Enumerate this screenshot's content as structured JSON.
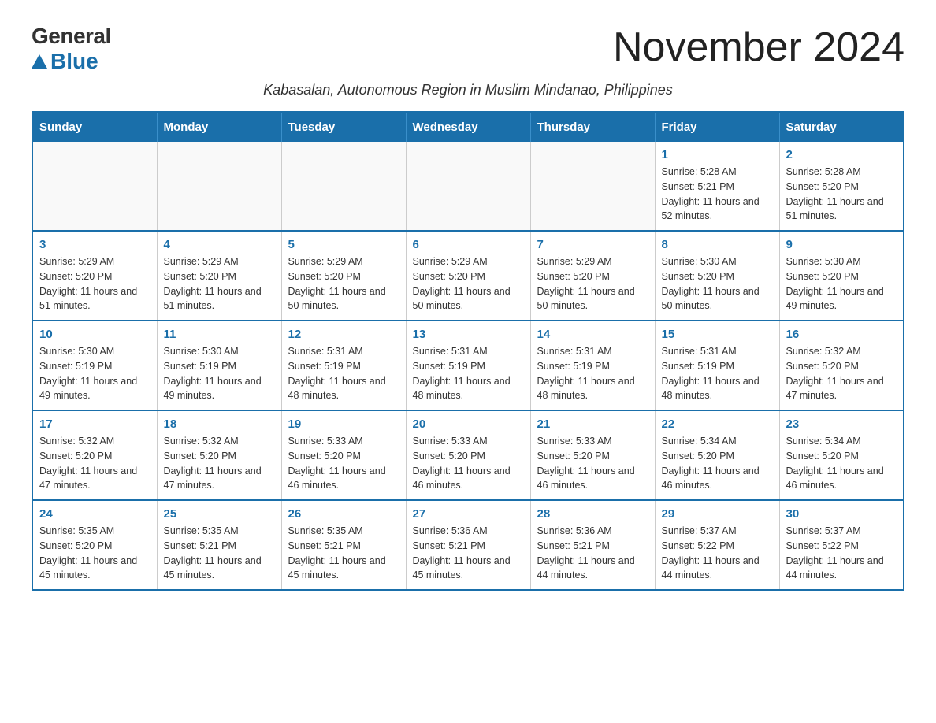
{
  "logo": {
    "general": "General",
    "blue": "Blue"
  },
  "title": "November 2024",
  "subtitle": "Kabasalan, Autonomous Region in Muslim Mindanao, Philippines",
  "days_of_week": [
    "Sunday",
    "Monday",
    "Tuesday",
    "Wednesday",
    "Thursday",
    "Friday",
    "Saturday"
  ],
  "weeks": [
    [
      {
        "day": "",
        "info": ""
      },
      {
        "day": "",
        "info": ""
      },
      {
        "day": "",
        "info": ""
      },
      {
        "day": "",
        "info": ""
      },
      {
        "day": "",
        "info": ""
      },
      {
        "day": "1",
        "info": "Sunrise: 5:28 AM\nSunset: 5:21 PM\nDaylight: 11 hours and 52 minutes."
      },
      {
        "day": "2",
        "info": "Sunrise: 5:28 AM\nSunset: 5:20 PM\nDaylight: 11 hours and 51 minutes."
      }
    ],
    [
      {
        "day": "3",
        "info": "Sunrise: 5:29 AM\nSunset: 5:20 PM\nDaylight: 11 hours and 51 minutes."
      },
      {
        "day": "4",
        "info": "Sunrise: 5:29 AM\nSunset: 5:20 PM\nDaylight: 11 hours and 51 minutes."
      },
      {
        "day": "5",
        "info": "Sunrise: 5:29 AM\nSunset: 5:20 PM\nDaylight: 11 hours and 50 minutes."
      },
      {
        "day": "6",
        "info": "Sunrise: 5:29 AM\nSunset: 5:20 PM\nDaylight: 11 hours and 50 minutes."
      },
      {
        "day": "7",
        "info": "Sunrise: 5:29 AM\nSunset: 5:20 PM\nDaylight: 11 hours and 50 minutes."
      },
      {
        "day": "8",
        "info": "Sunrise: 5:30 AM\nSunset: 5:20 PM\nDaylight: 11 hours and 50 minutes."
      },
      {
        "day": "9",
        "info": "Sunrise: 5:30 AM\nSunset: 5:20 PM\nDaylight: 11 hours and 49 minutes."
      }
    ],
    [
      {
        "day": "10",
        "info": "Sunrise: 5:30 AM\nSunset: 5:19 PM\nDaylight: 11 hours and 49 minutes."
      },
      {
        "day": "11",
        "info": "Sunrise: 5:30 AM\nSunset: 5:19 PM\nDaylight: 11 hours and 49 minutes."
      },
      {
        "day": "12",
        "info": "Sunrise: 5:31 AM\nSunset: 5:19 PM\nDaylight: 11 hours and 48 minutes."
      },
      {
        "day": "13",
        "info": "Sunrise: 5:31 AM\nSunset: 5:19 PM\nDaylight: 11 hours and 48 minutes."
      },
      {
        "day": "14",
        "info": "Sunrise: 5:31 AM\nSunset: 5:19 PM\nDaylight: 11 hours and 48 minutes."
      },
      {
        "day": "15",
        "info": "Sunrise: 5:31 AM\nSunset: 5:19 PM\nDaylight: 11 hours and 48 minutes."
      },
      {
        "day": "16",
        "info": "Sunrise: 5:32 AM\nSunset: 5:20 PM\nDaylight: 11 hours and 47 minutes."
      }
    ],
    [
      {
        "day": "17",
        "info": "Sunrise: 5:32 AM\nSunset: 5:20 PM\nDaylight: 11 hours and 47 minutes."
      },
      {
        "day": "18",
        "info": "Sunrise: 5:32 AM\nSunset: 5:20 PM\nDaylight: 11 hours and 47 minutes."
      },
      {
        "day": "19",
        "info": "Sunrise: 5:33 AM\nSunset: 5:20 PM\nDaylight: 11 hours and 46 minutes."
      },
      {
        "day": "20",
        "info": "Sunrise: 5:33 AM\nSunset: 5:20 PM\nDaylight: 11 hours and 46 minutes."
      },
      {
        "day": "21",
        "info": "Sunrise: 5:33 AM\nSunset: 5:20 PM\nDaylight: 11 hours and 46 minutes."
      },
      {
        "day": "22",
        "info": "Sunrise: 5:34 AM\nSunset: 5:20 PM\nDaylight: 11 hours and 46 minutes."
      },
      {
        "day": "23",
        "info": "Sunrise: 5:34 AM\nSunset: 5:20 PM\nDaylight: 11 hours and 46 minutes."
      }
    ],
    [
      {
        "day": "24",
        "info": "Sunrise: 5:35 AM\nSunset: 5:20 PM\nDaylight: 11 hours and 45 minutes."
      },
      {
        "day": "25",
        "info": "Sunrise: 5:35 AM\nSunset: 5:21 PM\nDaylight: 11 hours and 45 minutes."
      },
      {
        "day": "26",
        "info": "Sunrise: 5:35 AM\nSunset: 5:21 PM\nDaylight: 11 hours and 45 minutes."
      },
      {
        "day": "27",
        "info": "Sunrise: 5:36 AM\nSunset: 5:21 PM\nDaylight: 11 hours and 45 minutes."
      },
      {
        "day": "28",
        "info": "Sunrise: 5:36 AM\nSunset: 5:21 PM\nDaylight: 11 hours and 44 minutes."
      },
      {
        "day": "29",
        "info": "Sunrise: 5:37 AM\nSunset: 5:22 PM\nDaylight: 11 hours and 44 minutes."
      },
      {
        "day": "30",
        "info": "Sunrise: 5:37 AM\nSunset: 5:22 PM\nDaylight: 11 hours and 44 minutes."
      }
    ]
  ]
}
